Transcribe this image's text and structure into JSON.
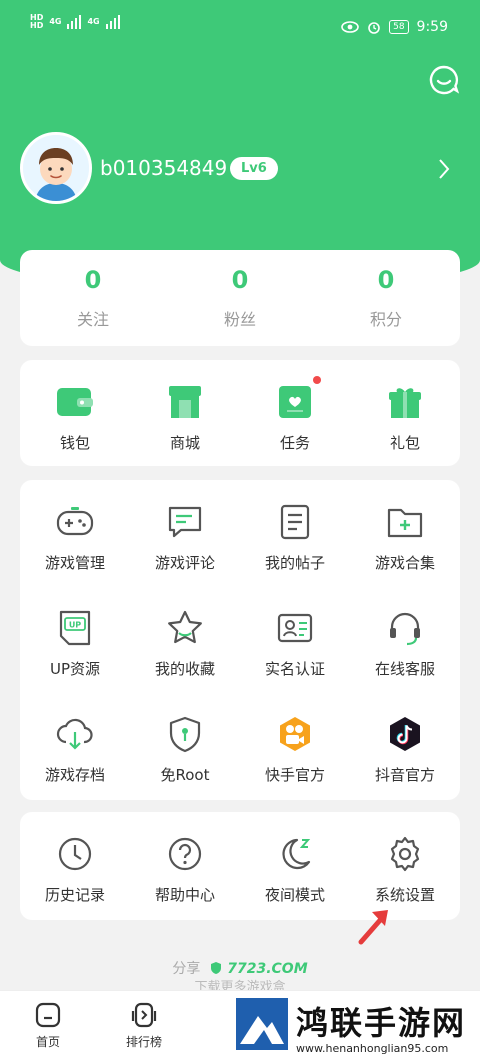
{
  "status_bar": {
    "network_left_1": "HD",
    "network_left_2": "HD",
    "signal_1": "4G",
    "signal_2": "4G",
    "battery": "58",
    "time": "9:59"
  },
  "profile": {
    "username": "b010354849",
    "level": "Lv6"
  },
  "stats": [
    {
      "value": "0",
      "label": "关注"
    },
    {
      "value": "0",
      "label": "粉丝"
    },
    {
      "value": "0",
      "label": "积分"
    }
  ],
  "quick": [
    {
      "label": "钱包",
      "icon": "wallet-icon"
    },
    {
      "label": "商城",
      "icon": "shop-icon"
    },
    {
      "label": "任务",
      "icon": "task-icon"
    },
    {
      "label": "礼包",
      "icon": "gift-icon"
    }
  ],
  "grid": [
    {
      "label": "游戏管理",
      "icon": "gamepad-icon"
    },
    {
      "label": "游戏评论",
      "icon": "comment-icon"
    },
    {
      "label": "我的帖子",
      "icon": "post-icon"
    },
    {
      "label": "游戏合集",
      "icon": "folder-add-icon"
    },
    {
      "label": "UP资源",
      "icon": "up-icon"
    },
    {
      "label": "我的收藏",
      "icon": "star-icon"
    },
    {
      "label": "实名认证",
      "icon": "id-card-icon"
    },
    {
      "label": "在线客服",
      "icon": "headset-icon"
    },
    {
      "label": "游戏存档",
      "icon": "cloud-download-icon"
    },
    {
      "label": "免Root",
      "icon": "shield-icon"
    },
    {
      "label": "快手官方",
      "icon": "kuaishou-icon"
    },
    {
      "label": "抖音官方",
      "icon": "douyin-icon"
    }
  ],
  "settings": [
    {
      "label": "历史记录",
      "icon": "clock-icon"
    },
    {
      "label": "帮助中心",
      "icon": "help-icon"
    },
    {
      "label": "夜间模式",
      "icon": "moon-icon"
    },
    {
      "label": "系统设置",
      "icon": "gear-icon"
    }
  ],
  "share": {
    "prefix": "分享",
    "site": "7723.COM",
    "sub": "下载更多游戏盒"
  },
  "tabs": [
    {
      "label": "首页",
      "icon": "home-icon"
    },
    {
      "label": "排行榜",
      "icon": "ranking-icon"
    }
  ],
  "watermark": {
    "title": "鸿联手游网",
    "url": "www.henanhonglian95.com"
  },
  "colors": {
    "brand": "#3ec978",
    "badge": "#f14b4b",
    "arrow": "#e53c3c"
  }
}
